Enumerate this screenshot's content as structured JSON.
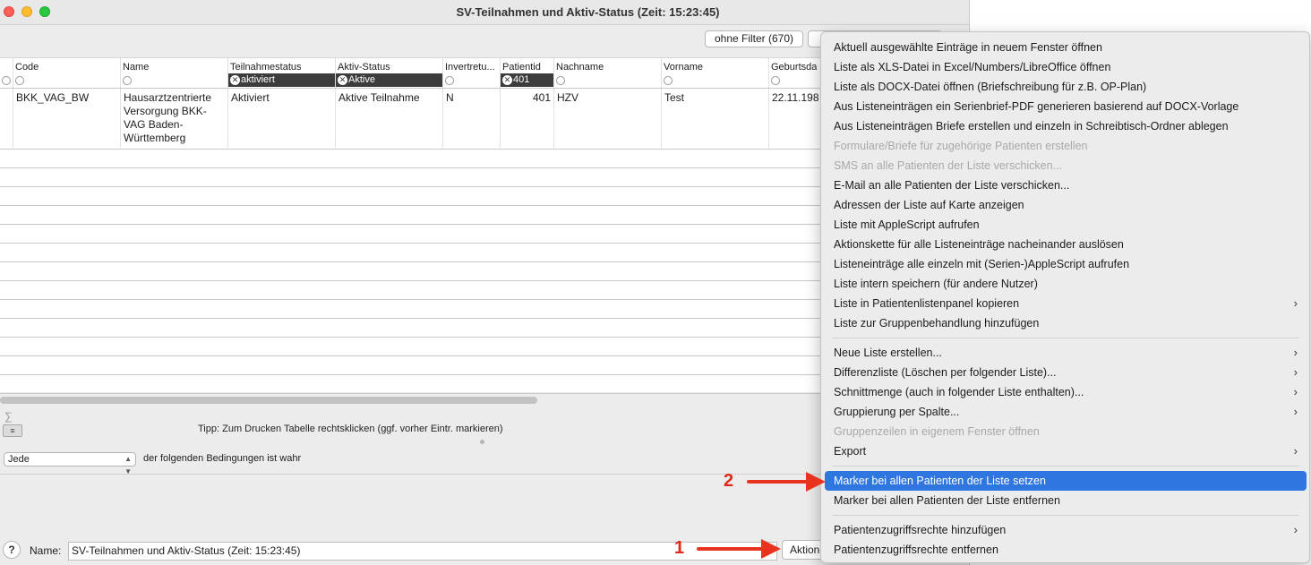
{
  "window": {
    "title": "SV-Teilnahmen und Aktiv-Status  (Zeit: 15:23:45)",
    "filter_button": "ohne Filter (670)"
  },
  "table": {
    "columns": [
      {
        "label": "",
        "filter": null
      },
      {
        "label": "Code",
        "filter": null
      },
      {
        "label": "Name",
        "filter": null
      },
      {
        "label": "Teilnahmestatus",
        "filter": "aktiviert"
      },
      {
        "label": "Aktiv-Status",
        "filter": "Aktive"
      },
      {
        "label": "Invertretu...",
        "filter": null
      },
      {
        "label": "Patientid",
        "filter": "401"
      },
      {
        "label": "Nachname",
        "filter": null
      },
      {
        "label": "Vorname",
        "filter": null
      },
      {
        "label": "Geburtsda",
        "filter": null
      }
    ],
    "rows": [
      [
        "",
        "BKK_VAG_BW",
        "Hausarztzentrierte Versorgung BKK-VAG Baden-Württemberg",
        "Aktiviert",
        "Aktive Teilnahme",
        "N",
        "401",
        "HZV",
        "Test",
        "22.11.198"
      ]
    ]
  },
  "footer": {
    "sum_symbol": "∑",
    "list_icon": "≡",
    "tip": "Tipp: Zum Drucken Tabelle rechtsklicken (ggf. vorher Eintr. markieren)",
    "condition_select": "Jede",
    "condition_text": "der folgenden Bedingungen ist wahr",
    "help_label": "?",
    "name_label": "Name:",
    "name_value": "SV-Teilnahmen und Aktiv-Status  (Zeit: 15:23:45)",
    "action_button": "Aktionen"
  },
  "menu": {
    "items": [
      {
        "label": "Aktuell ausgewählte Einträge in neuem Fenster öffnen",
        "disabled": false
      },
      {
        "label": "Liste als XLS-Datei in Excel/Numbers/LibreOffice öffnen",
        "disabled": false
      },
      {
        "label": "Liste als DOCX-Datei öffnen (Briefschreibung für z.B. OP-Plan)",
        "disabled": false
      },
      {
        "label": "Aus Listeneinträgen ein Serienbrief-PDF generieren basierend auf DOCX-Vorlage",
        "disabled": false
      },
      {
        "label": "Aus Listeneinträgen Briefe erstellen und einzeln in Schreibtisch-Ordner ablegen",
        "disabled": false
      },
      {
        "label": "Formulare/Briefe für zugehörige Patienten erstellen",
        "disabled": true
      },
      {
        "label": "SMS an alle Patienten der Liste verschicken...",
        "disabled": true
      },
      {
        "label": "E-Mail an alle Patienten der Liste verschicken...",
        "disabled": false
      },
      {
        "label": "Adressen der Liste auf Karte anzeigen",
        "disabled": false
      },
      {
        "label": "Liste mit AppleScript aufrufen",
        "disabled": false
      },
      {
        "label": "Aktionskette für alle Listeneinträge nacheinander auslösen",
        "disabled": false
      },
      {
        "label": "Listeneinträge alle einzeln mit (Serien-)AppleScript aufrufen",
        "disabled": false
      },
      {
        "label": "Liste intern speichern (für andere Nutzer)",
        "disabled": false
      },
      {
        "label": "Liste in Patientenlistenpanel kopieren",
        "disabled": false,
        "submenu": true
      },
      {
        "label": "Liste zur Gruppenbehandlung hinzufügen",
        "disabled": false
      },
      {
        "label": "Neue Liste erstellen...",
        "disabled": false,
        "submenu": true,
        "separator_before": true
      },
      {
        "label": "Differenzliste (Löschen per folgender Liste)...",
        "disabled": false,
        "submenu": true
      },
      {
        "label": "Schnittmenge (auch in folgender Liste enthalten)...",
        "disabled": false,
        "submenu": true
      },
      {
        "label": "Gruppierung per Spalte...",
        "disabled": false,
        "submenu": true
      },
      {
        "label": "Gruppenzeilen in eigenem Fenster öffnen",
        "disabled": true
      },
      {
        "label": "Export",
        "disabled": false,
        "submenu": true
      },
      {
        "label": "Marker bei allen Patienten der Liste setzen",
        "disabled": false,
        "selected": true,
        "separator_before": true
      },
      {
        "label": "Marker bei allen Patienten der Liste entfernen",
        "disabled": false
      },
      {
        "label": "Patientenzugriffsrechte hinzufügen",
        "disabled": false,
        "submenu": true,
        "separator_before": true
      },
      {
        "label": "Patientenzugriffsrechte entfernen",
        "disabled": false
      }
    ],
    "submenu_glyph": "›",
    "selected_color": "#2f76e0"
  },
  "annotations": {
    "arrow_1_label": "1",
    "arrow_2_label": "2",
    "arrow_color": "#e8341f"
  }
}
